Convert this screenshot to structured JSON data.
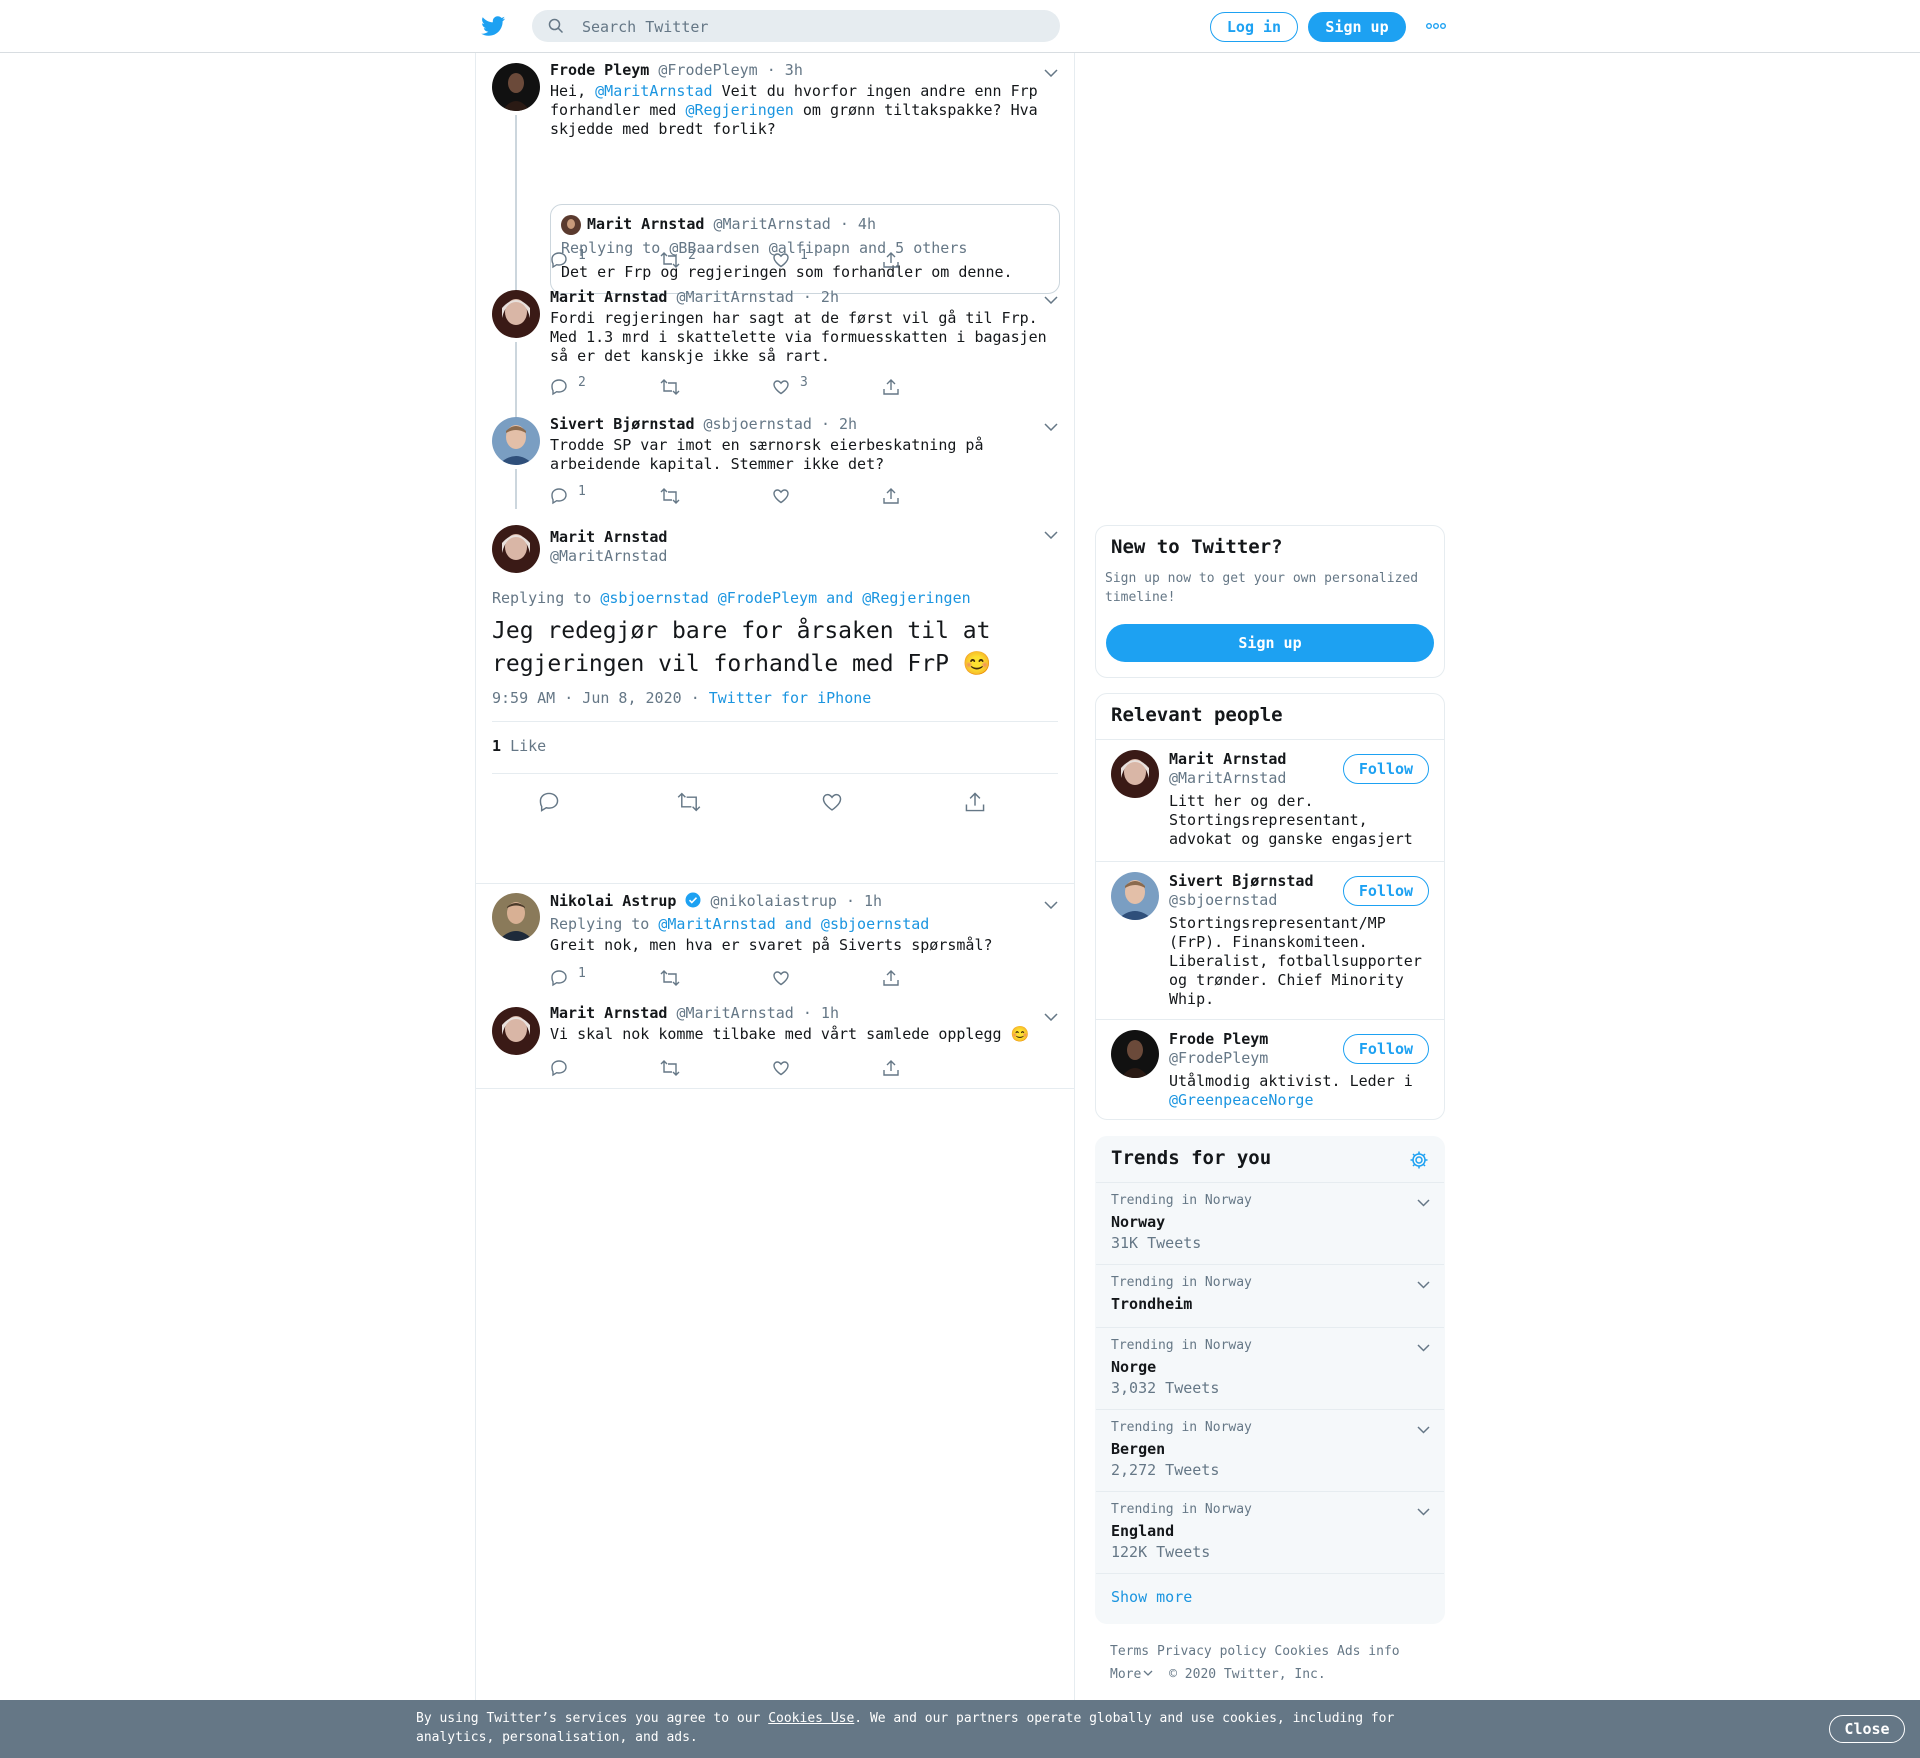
{
  "topbar": {
    "search_placeholder": "Search Twitter",
    "login_label": "Log in",
    "signup_label": "Sign up"
  },
  "thread": [
    {
      "name": "Frode Pleym",
      "handle": "@FrodePleym",
      "time": "· 3h",
      "text_parts": [
        "Hei, ",
        "@MaritArnstad",
        " Veit du hvorfor ingen andre enn Frp\nforhandler med ",
        "@Regjeringen",
        " om grønn tiltakspakke? Hva\nskjedde med bredt forlik?"
      ],
      "quote": {
        "name": "Marit Arnstad",
        "handle": "@MaritArnstad",
        "time": "· 4h",
        "replying": "Replying to @BBaardsen @alfipapn and 5 others",
        "text": "Det er Frp og regjeringen som forhandler om denne."
      },
      "replies": "1",
      "retweets": "2",
      "likes": "1"
    },
    {
      "name": "Marit Arnstad",
      "handle": "@MaritArnstad",
      "time": "· 2h",
      "text": "Fordi regjeringen har sagt at de først vil gå til Frp.\nMed 1.3 mrd i skattelette via formuesskatten i bagasjen\nså er det kanskje ikke så rart.",
      "replies": "2",
      "retweets": "",
      "likes": "3"
    },
    {
      "name": "Sivert Bjørnstad",
      "handle": "@sbjoernstad",
      "time": "· 2h",
      "text": "Trodde SP var imot en særnorsk eierbeskatning på\narbeidende kapital. Stemmer ikke det?",
      "replies": "1",
      "retweets": "",
      "likes": ""
    }
  ],
  "focal": {
    "name": "Marit Arnstad",
    "handle": "@MaritArnstad",
    "replying_prefix": "Replying to ",
    "replying_targets": "@sbjoernstad @FrodePleym and @Regjeringen",
    "text": "Jeg redegjør bare for årsaken til at\nregjeringen vil forhandle med FrP 😊",
    "timestamp": "9:59 AM · Jun 8, 2020",
    "source": "Twitter for iPhone",
    "like_count": "1",
    "like_label": "Like"
  },
  "replies": [
    {
      "name": "Nikolai Astrup",
      "handle": "@nikolaiastrup",
      "time": "· 1h",
      "replying_prefix": "Replying to ",
      "replying_targets": "@MaritArnstad and @sbjoernstad",
      "text": "Greit nok, men hva er svaret på Siverts spørsmål?",
      "replies": "1"
    },
    {
      "name": "Marit Arnstad",
      "handle": "@MaritArnstad",
      "time": "· 1h",
      "text": "Vi skal nok komme tilbake med vårt samlede opplegg 😊",
      "replies": ""
    }
  ],
  "new_to_twitter": {
    "title": "New to Twitter?",
    "subtitle": "Sign up now to get your own personalized\ntimeline!",
    "button": "Sign up"
  },
  "relevant_people": {
    "title": "Relevant people",
    "follow_label": "Follow",
    "people": [
      {
        "name": "Marit Arnstad",
        "handle": "@MaritArnstad",
        "bio": "Litt her og der.\nStortingsrepresentant,\nadvokat og ganske engasjert"
      },
      {
        "name": "Sivert Bjørnstad",
        "handle": "@sbjoernstad",
        "bio": "Stortingsrepresentant/MP\n(FrP). Finanskomiteen.\nLiberalist, fotballsupporter\nog trønder. Chief Minority\nWhip."
      },
      {
        "name": "Frode Pleym",
        "handle": "@FrodePleym",
        "bio": "Utålmodig aktivist. Leder i",
        "bio_link": "@GreenpeaceNorge"
      }
    ]
  },
  "trends": {
    "title": "Trends for you",
    "items": [
      {
        "context": "Trending in Norway",
        "name": "Norway",
        "count": "31K Tweets"
      },
      {
        "context": "Trending in Norway",
        "name": "Trondheim",
        "count": ""
      },
      {
        "context": "Trending in Norway",
        "name": "Norge",
        "count": "3,032 Tweets"
      },
      {
        "context": "Trending in Norway",
        "name": "Bergen",
        "count": "2,272 Tweets"
      },
      {
        "context": "Trending in Norway",
        "name": "England",
        "count": "122K Tweets"
      }
    ],
    "show_more": "Show more"
  },
  "footer": {
    "terms": "Terms",
    "privacy": "Privacy policy",
    "cookies": "Cookies",
    "ads": "Ads info",
    "more": "More",
    "copyright": "© 2020 Twitter, Inc."
  },
  "cookie_bar": {
    "prefix": "By using Twitter’s services you agree to our ",
    "link": "Cookies Use",
    "suffix": ". We and our partners operate globally and use cookies, including for\nanalytics, personalisation, and ads.",
    "close": "Close"
  },
  "colors": {
    "accent": "#1da1f2",
    "link": "#1b95e0",
    "secondary_text": "#657786",
    "cookie_bar": "#657786",
    "verified": "#1da1f2"
  },
  "icons": [
    "twitter-bird-icon",
    "search-icon",
    "more-dots-icon",
    "reply-icon",
    "retweet-icon",
    "like-icon",
    "share-icon",
    "chevron-down-icon",
    "gear-icon",
    "verified-badge-icon"
  ]
}
